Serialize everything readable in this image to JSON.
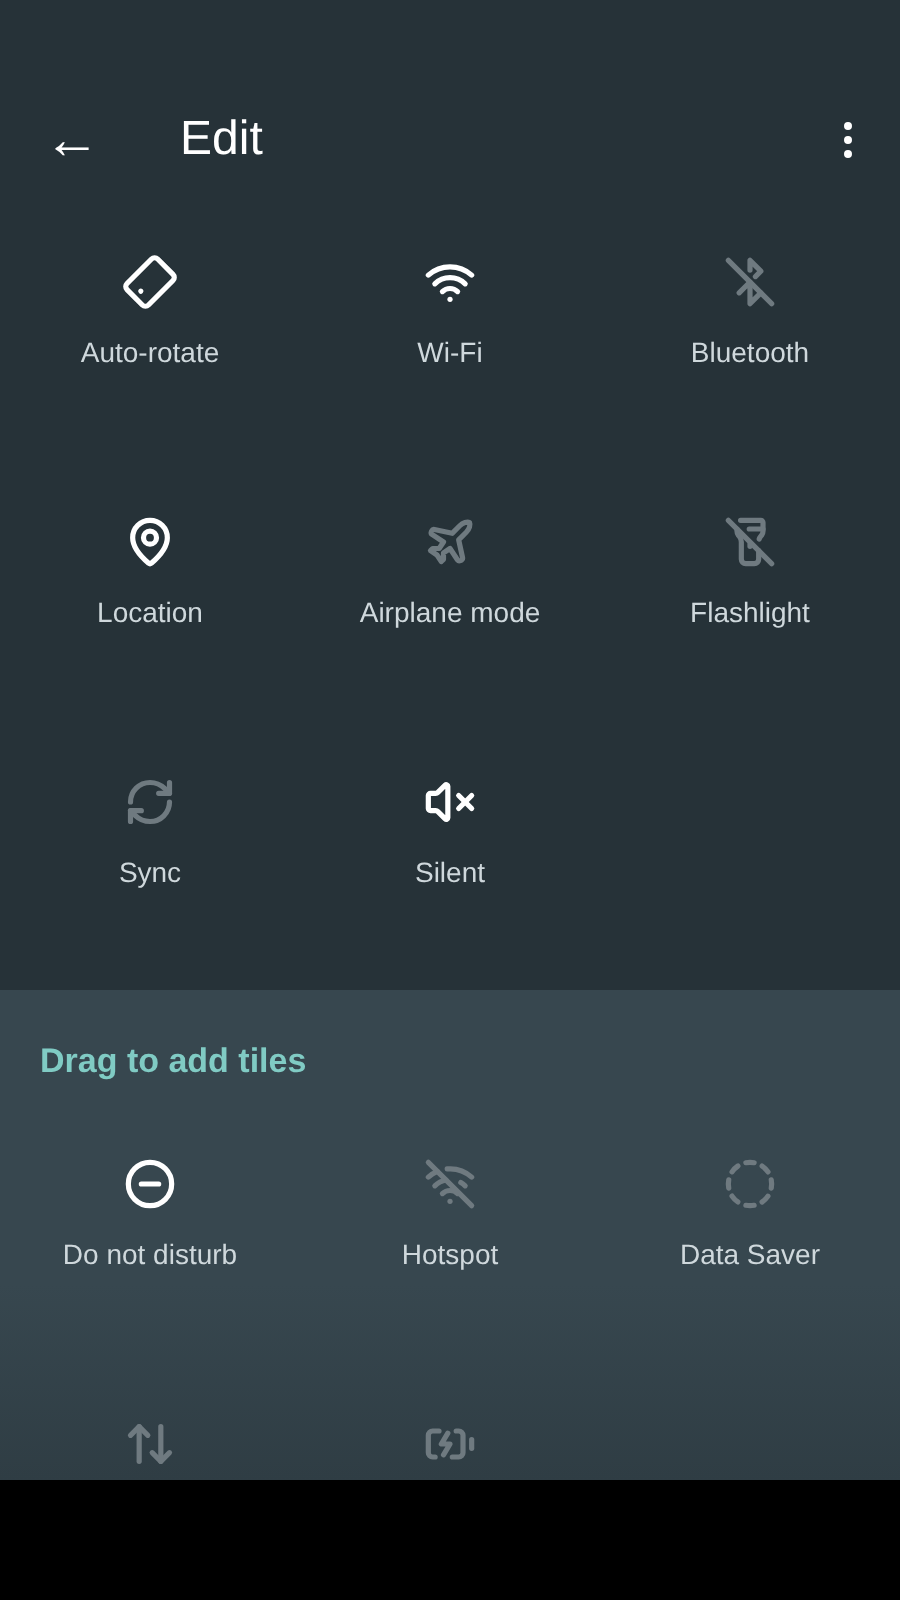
{
  "header": {
    "back_icon": "←",
    "title": "Edit"
  },
  "active_tiles": [
    {
      "kind": "rotate",
      "label": "Auto-rotate",
      "on": true
    },
    {
      "kind": "wifi",
      "label": "Wi-Fi",
      "on": true
    },
    {
      "kind": "bluetooth",
      "label": "Bluetooth",
      "on": false
    },
    {
      "kind": "location",
      "label": "Location",
      "on": true
    },
    {
      "kind": "airplane",
      "label": "Airplane mode",
      "on": false
    },
    {
      "kind": "flashlight",
      "label": "Flashlight",
      "on": false
    },
    {
      "kind": "sync",
      "label": "Sync",
      "on": false
    },
    {
      "kind": "silent",
      "label": "Silent",
      "on": true
    }
  ],
  "available": {
    "title": "Drag to add tiles",
    "tiles": [
      {
        "kind": "dnd",
        "label": "Do not disturb",
        "on": true
      },
      {
        "kind": "hotspot",
        "label": "Hotspot",
        "on": false
      },
      {
        "kind": "datasaver",
        "label": "Data Saver",
        "on": false
      },
      {
        "kind": "data",
        "on": false
      },
      {
        "kind": "battery",
        "on": false
      }
    ]
  }
}
